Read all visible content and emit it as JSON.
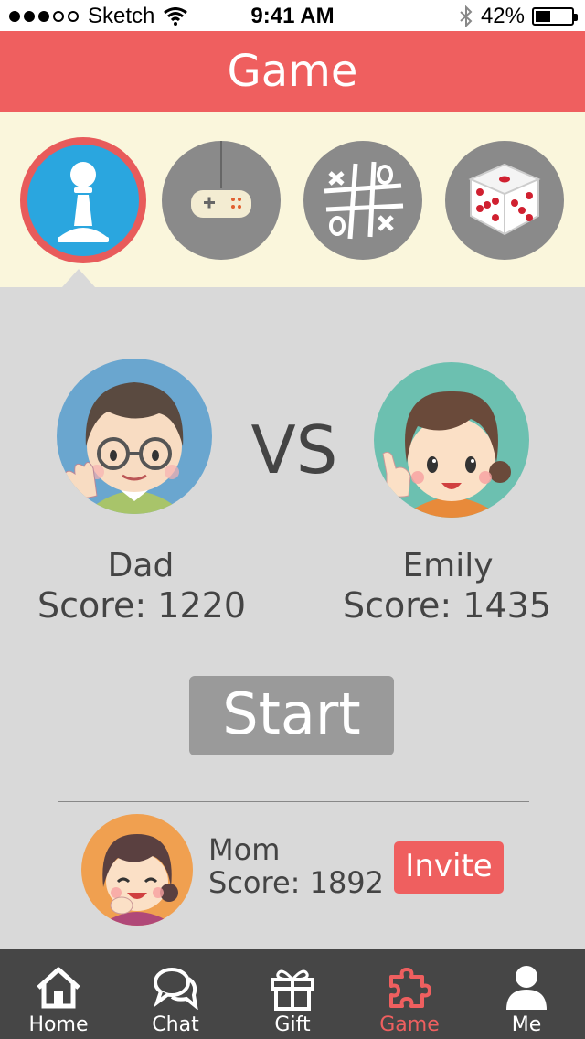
{
  "status_bar": {
    "carrier": "Sketch",
    "time": "9:41 AM",
    "battery": "42%",
    "battery_level": 0.42
  },
  "header": {
    "title": "Game"
  },
  "game_picker": {
    "items": [
      {
        "name": "chess",
        "icon": "chess-pawn-icon",
        "selected": true
      },
      {
        "name": "controller",
        "icon": "gamepad-icon",
        "selected": false
      },
      {
        "name": "tic-tac-toe",
        "icon": "tic-tac-toe-icon",
        "selected": false
      },
      {
        "name": "dice",
        "icon": "dice-icon",
        "selected": false
      }
    ]
  },
  "match": {
    "vs_label": "VS",
    "player1": {
      "name": "Dad",
      "score": "Score: 1220"
    },
    "player2": {
      "name": "Emily",
      "score": "Score: 1435"
    },
    "start_label": "Start"
  },
  "invite": {
    "name": "Mom",
    "score": "Score: 1892",
    "button_label": "Invite"
  },
  "tabs": [
    {
      "label": "Home",
      "icon": "home-icon",
      "active": false
    },
    {
      "label": "Chat",
      "icon": "chat-icon",
      "active": false
    },
    {
      "label": "Gift",
      "icon": "gift-icon",
      "active": false
    },
    {
      "label": "Game",
      "icon": "puzzle-icon",
      "active": true
    },
    {
      "label": "Me",
      "icon": "person-icon",
      "active": false
    }
  ],
  "colors": {
    "accent": "#ef5f5f",
    "selected_game": "#2aa6df",
    "tab_bar": "#464646"
  }
}
